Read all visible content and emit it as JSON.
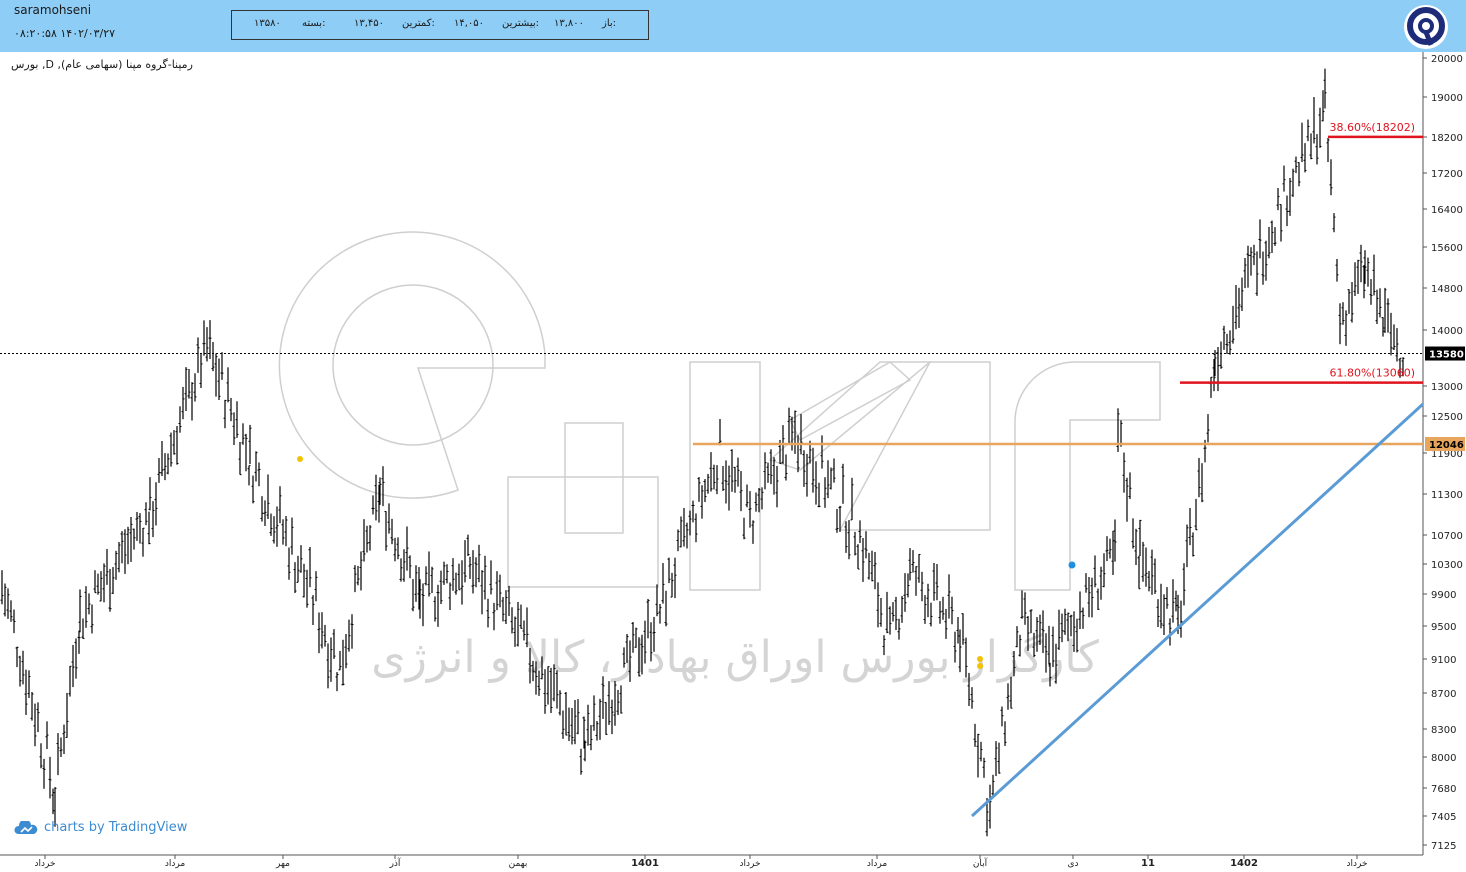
{
  "header": {
    "username": "saramohseni",
    "datetime": "۱۴۰۲/۰۳/۲۷ ۰۸:۲۰:۵۸",
    "ohlc": {
      "open_label": "باز:",
      "open_value": "۱۳,۸۰۰",
      "high_label": "بیشترین:",
      "high_value": "۱۴,۰۵۰",
      "low_label": "کمترین:",
      "low_value": "۱۳,۴۵۰",
      "close_label": "بسته:",
      "close_value": "۱۳۵۸۰"
    },
    "logo": "brand-logo-icon"
  },
  "symbol_title": "رمپنا-گروه مپنا (سهامی عام), D, بورس",
  "watermark": "کارگزار بورس اوراق بهادار، کالا و انرژی",
  "tradingview_credit": "charts by TradingView",
  "colors": {
    "header_bg": "#8ecdf5",
    "bar": "#000000",
    "support_line": "#e8a55c",
    "fib_line": "#e0141e",
    "fib_text": "#e0141e",
    "trendline": "#5b9bd5",
    "current_price_label_bg": "#000000",
    "support_label_bg": "#e8a55c"
  },
  "chart_data": {
    "type": "ohlc",
    "y_ticks": [
      20000,
      19000,
      18200,
      17200,
      16400,
      15600,
      14800,
      14000,
      13000,
      12500,
      11900,
      11300,
      10700,
      10300,
      9900,
      9500,
      9100,
      8700,
      8300,
      8000,
      7680,
      7405,
      7125
    ],
    "x_labels": [
      "خرداد",
      "مرداد",
      "مهر",
      "آذر",
      "بهمن",
      "1401",
      "خرداد",
      "مرداد",
      "آبان",
      "دی",
      "11",
      "1402",
      "خرداد"
    ],
    "current_price": 13580,
    "current_price_label": "13580",
    "support_level": 12046,
    "support_label": "12046",
    "fib_levels": [
      {
        "label": "38.60%(18202)",
        "value": 18202
      },
      {
        "label": "61.80%(13060)",
        "value": 13060
      }
    ],
    "trendline": {
      "from": {
        "x": "آبان 1401",
        "y": 7405
      },
      "to": {
        "x": "خرداد 1402",
        "y": 12700
      }
    },
    "keypoints": [
      {
        "x": "خرداد",
        "y": 10000
      },
      {
        "x": "",
        "y": 7600
      },
      {
        "x": "",
        "y": 9600
      },
      {
        "x": "مرداد",
        "y": 11000
      },
      {
        "x": "",
        "y": 13700
      },
      {
        "x": "مهر",
        "y": 11800
      },
      {
        "x": "",
        "y": 9000
      },
      {
        "x": "آذر",
        "y": 11300
      },
      {
        "x": "",
        "y": 9800
      },
      {
        "x": "بهمن",
        "y": 10300
      },
      {
        "x": "",
        "y": 8100
      },
      {
        "x": "1401",
        "y": 9700
      },
      {
        "x": "",
        "y": 11900
      },
      {
        "x": "خرداد",
        "y": 10900
      },
      {
        "x": "",
        "y": 12200
      },
      {
        "x": "مرداد",
        "y": 10700
      },
      {
        "x": "",
        "y": 9300
      },
      {
        "x": "",
        "y": 10200
      },
      {
        "x": "",
        "y": 9400
      },
      {
        "x": "آبان",
        "y": 7450
      },
      {
        "x": "",
        "y": 9500
      },
      {
        "x": "دی",
        "y": 9100
      },
      {
        "x": "",
        "y": 10400
      },
      {
        "x": "",
        "y": 12200
      },
      {
        "x": "11",
        "y": 10400
      },
      {
        "x": "",
        "y": 9500
      },
      {
        "x": "",
        "y": 11900
      },
      {
        "x": "1402",
        "y": 13500
      },
      {
        "x": "",
        "y": 15500
      },
      {
        "x": "",
        "y": 18700
      },
      {
        "x": "خرداد",
        "y": 14200
      },
      {
        "x": "",
        "y": 15100
      },
      {
        "x": "",
        "y": 14100
      },
      {
        "x": "",
        "y": 13580
      }
    ]
  }
}
